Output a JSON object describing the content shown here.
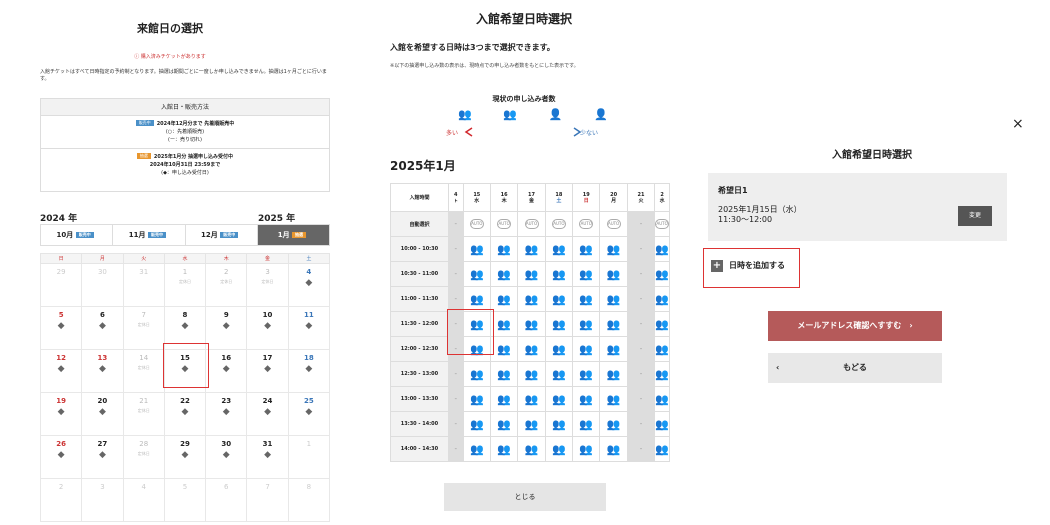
{
  "p1": {
    "title": "来館日の選択",
    "warning": "ⓘ 購入済みチケットがあります",
    "note": "入館チケットはすべて日時指定の予約制となります。抽選は期間ごとに一度しか申し込みできません。抽選は1ヶ月ごとに行います。",
    "info_head": "入館日・販売方法",
    "tag_sale": "販売中",
    "info1_line1": "2024年12月分まで 先着順販売中",
    "info1_line2": "(○：先着順販売)",
    "info1_line3": "(ー：売り切れ)",
    "tag_lottery": "抽選",
    "info2_line1": "2025年1月分 抽選申し込み受付中",
    "info2_line2": "2024年10月31日 23:59まで",
    "info2_line3": "(◆：申し込み受付日)",
    "year_left": "2024 年",
    "year_right": "2025 年",
    "months": [
      "10月",
      "11月",
      "12月",
      "1月"
    ],
    "weekdays": [
      "日",
      "月",
      "火",
      "水",
      "木",
      "金",
      "土"
    ],
    "closed_label": "定休日",
    "diamond": "◆",
    "weeks": [
      [
        {
          "d": "29",
          "t": "other"
        },
        {
          "d": "30",
          "t": "other"
        },
        {
          "d": "31",
          "t": "other"
        },
        {
          "d": "1",
          "t": "closed"
        },
        {
          "d": "2",
          "t": "closed"
        },
        {
          "d": "3",
          "t": "closed"
        },
        {
          "d": "4",
          "t": "sat",
          "s": 1
        }
      ],
      [
        {
          "d": "5",
          "t": "sun",
          "s": 1
        },
        {
          "d": "6",
          "s": 1
        },
        {
          "d": "7",
          "t": "closed"
        },
        {
          "d": "8",
          "s": 1
        },
        {
          "d": "9",
          "s": 1
        },
        {
          "d": "10",
          "s": 1
        },
        {
          "d": "11",
          "t": "sat",
          "s": 1
        }
      ],
      [
        {
          "d": "12",
          "t": "sun",
          "s": 1
        },
        {
          "d": "13",
          "t": "sun",
          "s": 1
        },
        {
          "d": "14",
          "t": "closed"
        },
        {
          "d": "15",
          "s": 1
        },
        {
          "d": "16",
          "s": 1
        },
        {
          "d": "17",
          "s": 1
        },
        {
          "d": "18",
          "t": "sat",
          "s": 1
        }
      ],
      [
        {
          "d": "19",
          "t": "sun",
          "s": 1
        },
        {
          "d": "20",
          "s": 1
        },
        {
          "d": "21",
          "t": "closed"
        },
        {
          "d": "22",
          "s": 1
        },
        {
          "d": "23",
          "s": 1
        },
        {
          "d": "24",
          "s": 1
        },
        {
          "d": "25",
          "t": "sat",
          "s": 1
        }
      ],
      [
        {
          "d": "26",
          "t": "sun",
          "s": 1
        },
        {
          "d": "27",
          "s": 1
        },
        {
          "d": "28",
          "t": "closed"
        },
        {
          "d": "29",
          "s": 1
        },
        {
          "d": "30",
          "s": 1
        },
        {
          "d": "31",
          "s": 1
        },
        {
          "d": "1",
          "t": "other"
        }
      ],
      [
        {
          "d": "2",
          "t": "other"
        },
        {
          "d": "3",
          "t": "other"
        },
        {
          "d": "4",
          "t": "other"
        },
        {
          "d": "5",
          "t": "other"
        },
        {
          "d": "6",
          "t": "other"
        },
        {
          "d": "7",
          "t": "other"
        },
        {
          "d": "8",
          "t": "other"
        }
      ]
    ]
  },
  "p2": {
    "title": "入館希望日時選択",
    "subtitle": "入館を希望する日時は3つまで選択できます。",
    "note": "※以下の抽選申し込み数の表示は、現時点での申し込み者数をもとにした表示です。",
    "legend_title": "現状の申し込み者数",
    "more": "多い",
    "less": "少ない",
    "year_month": "2025年1月",
    "time_header": "入館時間",
    "auto_row": "自動選択",
    "auto": "AUTO",
    "na": "-",
    "days": [
      {
        "d": "4",
        "w": "ㇳ"
      },
      {
        "d": "15",
        "w": "水"
      },
      {
        "d": "16",
        "w": "木"
      },
      {
        "d": "17",
        "w": "金"
      },
      {
        "d": "18",
        "w": "土"
      },
      {
        "d": "19",
        "w": "日"
      },
      {
        "d": "20",
        "w": "月"
      },
      {
        "d": "21",
        "w": "火"
      },
      {
        "d": "2",
        "w": "水"
      }
    ],
    "times": [
      "10:00 - 10:30",
      "10:30 - 11:00",
      "11:00 - 11:30",
      "11:30 - 12:00",
      "12:00 - 12:30",
      "12:30 - 13:00",
      "13:00 - 13:30",
      "13:30 - 14:00",
      "14:00 - 14:30"
    ],
    "levels": [
      [
        "na",
        "red",
        "red",
        "red",
        "red",
        "red",
        "red",
        "na",
        "red"
      ],
      [
        "na",
        "red",
        "red",
        "red",
        "red",
        "red",
        "red",
        "na",
        "red"
      ],
      [
        "na",
        "red",
        "red",
        "red",
        "red",
        "red",
        "red",
        "na",
        "red"
      ],
      [
        "na",
        "yel",
        "red",
        "red",
        "red",
        "red",
        "red",
        "na",
        "red"
      ],
      [
        "na",
        "yel",
        "yel",
        "red",
        "red",
        "red",
        "yel",
        "na",
        "yel"
      ],
      [
        "na",
        "yel",
        "yel",
        "yel",
        "red",
        "red",
        "yel",
        "na",
        "yel"
      ],
      [
        "na",
        "yel",
        "yel",
        "red",
        "red",
        "red",
        "yel",
        "na",
        "yel"
      ],
      [
        "na",
        "yel",
        "yel",
        "yel",
        "yel",
        "red",
        "yel",
        "na",
        "yel"
      ],
      [
        "na",
        "yel",
        "yel",
        "yel",
        "yel",
        "yel",
        "yel",
        "na",
        "yel"
      ]
    ],
    "close": "とじる"
  },
  "p3": {
    "close_x": "×",
    "title": "入館希望日時選択",
    "req_title": "希望日1",
    "req_date": "2025年1月15日（水）",
    "req_time": "11:30〜12:00",
    "change": "変更",
    "add": "日時を追加する",
    "mail": "メールアドレス確認へすすむ　›",
    "back_arrow": "‹",
    "back": "もどる"
  },
  "colors": {
    "red": "#d2282e",
    "yellow": "#e2b40b",
    "teal": "#3aa5b8",
    "blue": "#3a76b8",
    "selected": "#dd3333"
  }
}
